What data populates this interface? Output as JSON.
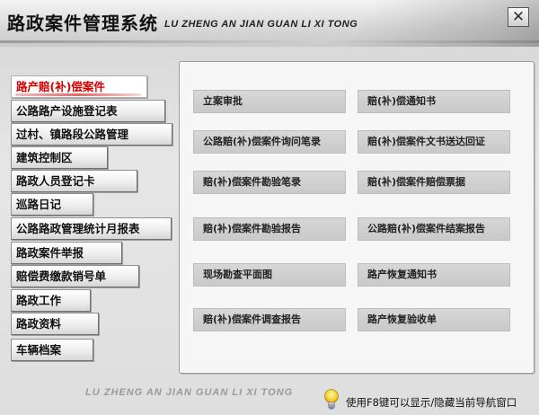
{
  "header": {
    "title": "路政案件管理系统",
    "subtitle": "LU ZHENG AN JIAN GUAN LI XI TONG",
    "close_glyph": "✕"
  },
  "sidebar": {
    "items": [
      {
        "label": "路产赔(补)偿案件",
        "active": true
      },
      {
        "label": "公路路产设施登记表",
        "active": false
      },
      {
        "label": "过村、镇路段公路管理",
        "active": false
      },
      {
        "label": "建筑控制区",
        "active": false
      },
      {
        "label": "路政人员登记卡",
        "active": false
      },
      {
        "label": "巡路日记",
        "active": false
      },
      {
        "label": "公路路政管理统计月报表",
        "active": false
      },
      {
        "label": "路政案件举报",
        "active": false
      },
      {
        "label": "赔偿费缴款销号单",
        "active": false
      },
      {
        "label": "路政工作",
        "active": false
      },
      {
        "label": "路政资料",
        "active": false
      },
      {
        "label": "车辆档案",
        "active": false
      }
    ]
  },
  "panel": {
    "buttons": [
      {
        "label": "立案审批"
      },
      {
        "label": "赔(补)偿通知书"
      },
      {
        "label": "公路赔(补)偿案件询问笔录"
      },
      {
        "label": "赔(补)偿案件文书送达回证"
      },
      {
        "label": "赔(补)偿案件勘验笔录"
      },
      {
        "label": "赔(补)偿案件赔偿票据"
      },
      {
        "label": "赔(补)偿案件勘验报告"
      },
      {
        "label": "公路赔(补)偿案件结案报告"
      },
      {
        "label": "现场勘查平面图"
      },
      {
        "label": "路产恢复通知书"
      },
      {
        "label": "赔(补)偿案件调查报告"
      },
      {
        "label": "路产恢复验收单"
      }
    ]
  },
  "footer": {
    "brand": "LU ZHENG AN JIAN GUAN LI XI TONG",
    "tip_icon": "lightbulb-icon",
    "tip": "使用F8键可以显示/隐藏当前导航窗口"
  },
  "colors": {
    "active_nav_text": "#d40000",
    "action_button_bg": "#d0d0d0",
    "panel_bg": "#f6f6f6"
  }
}
